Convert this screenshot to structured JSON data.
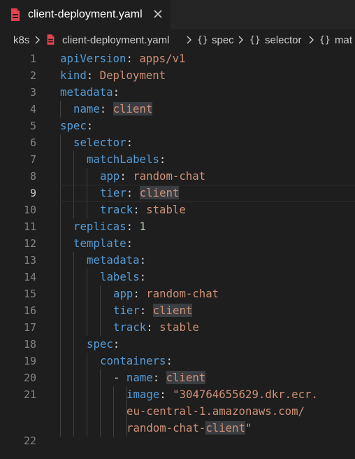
{
  "tab": {
    "filename": "client-deployment.yaml",
    "icon": "yaml-file-icon",
    "close_icon": "close-icon"
  },
  "breadcrumb": {
    "folder": "k8s",
    "file": "client-deployment.yaml",
    "items": [
      "spec",
      "selector",
      "mat"
    ]
  },
  "colors": {
    "background": "#1e1e1e",
    "key": "#569cd6",
    "string": "#ce9178",
    "number": "#b5cea8",
    "line_number": "#858585",
    "file_icon": "#e8424e"
  },
  "editor": {
    "active_line": "9",
    "line_numbers": [
      "1",
      "2",
      "3",
      "4",
      "5",
      "6",
      "7",
      "8",
      "9",
      "10",
      "11",
      "12",
      "13",
      "14",
      "15",
      "16",
      "17",
      "18",
      "19",
      "20",
      "21",
      "22"
    ],
    "lines": [
      {
        "k": "apiVersion",
        "v": "apps/v1"
      },
      {
        "k": "kind",
        "v": "Deployment"
      },
      {
        "k": "metadata"
      },
      {
        "k": "name",
        "v": "client"
      },
      {
        "k": "spec"
      },
      {
        "k": "selector"
      },
      {
        "k": "matchLabels"
      },
      {
        "k": "app",
        "v": "random-chat"
      },
      {
        "k": "tier",
        "v": "client"
      },
      {
        "k": "track",
        "v": "stable"
      },
      {
        "k": "replicas",
        "v": "1"
      },
      {
        "k": "template"
      },
      {
        "k": "metadata"
      },
      {
        "k": "labels"
      },
      {
        "k": "app",
        "v": "random-chat"
      },
      {
        "k": "tier",
        "v": "client"
      },
      {
        "k": "track",
        "v": "stable"
      },
      {
        "k": "spec"
      },
      {
        "k": "containers"
      },
      {
        "dash": "-",
        "k": "name",
        "v": "client"
      },
      {
        "k": "image",
        "v": "\"304764655629.dkr.ecr."
      },
      {
        "cont1": "eu-central-1.amazonaws.com/",
        "cont2a": "random-chat-",
        "cont2b": "client",
        "cont2c": "\""
      }
    ]
  }
}
